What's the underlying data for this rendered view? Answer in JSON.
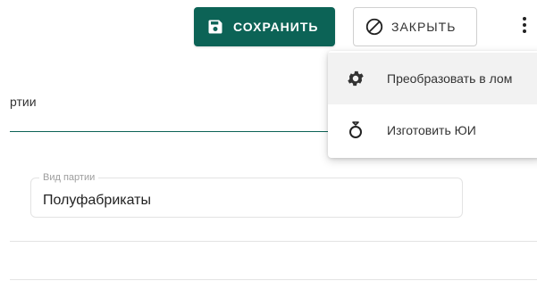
{
  "toolbar": {
    "save_label": "СОХРАНИТЬ",
    "close_label": "ЗАКРЫТЬ"
  },
  "form": {
    "field1_label_partial": "ртии",
    "field2_label": "Вид партии",
    "field2_value": "Полуфабрикаты"
  },
  "menu": {
    "items": [
      {
        "label": "Преобразовать в лом",
        "icon": "gear-icon"
      },
      {
        "label": "Изготовить ЮИ",
        "icon": "ring-icon"
      }
    ]
  },
  "colors": {
    "accent": "#0c6356",
    "menu_hover": "#f2f2f2"
  }
}
